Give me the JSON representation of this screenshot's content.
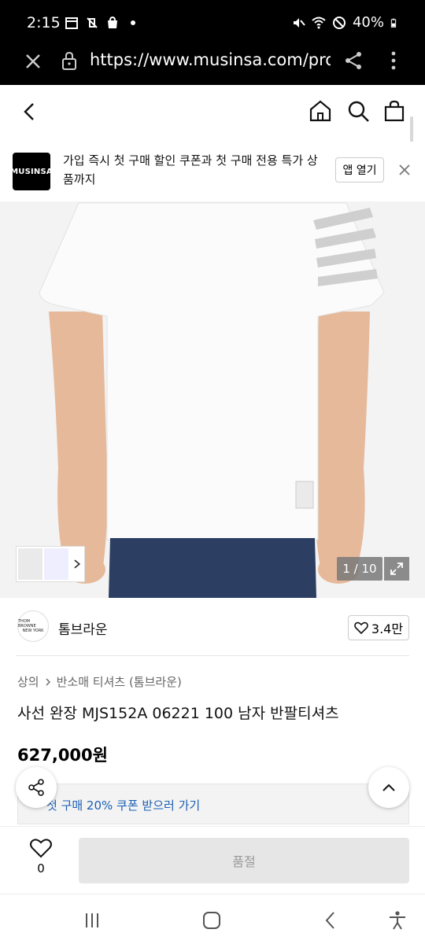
{
  "status_bar": {
    "time": "2:15",
    "battery": "40%"
  },
  "browser": {
    "url": "https://www.musinsa.com/produ"
  },
  "app_banner": {
    "logo_text": "MUSINSA",
    "message": "가입 즉시 첫 구매 할인 쿠폰과 첫 구매 전용 특가 상품까지",
    "open_button": "앱 열기"
  },
  "gallery": {
    "counter": "1 / 10"
  },
  "brand": {
    "logo_line1": "THOM BROWNE",
    "logo_line2": "NEW YORK",
    "name": "톰브라운",
    "like_count": "3.4만"
  },
  "breadcrumb": {
    "items": [
      "상의",
      "반소매 티셔츠 (톰브라운)"
    ]
  },
  "product": {
    "title": "사선 완장 MJS152A 06221 100 남자 반팔티셔츠",
    "price": "627,000원",
    "coupon_text": "첫 구매 20% 쿠폰 받으러 가기"
  },
  "purchase_bar": {
    "wish_count": "0",
    "button_label": "품절"
  },
  "colors": {
    "coupon_blue": "#1a5fb4",
    "soldout_bg": "#e6e6e6",
    "soldout_text": "#999999"
  }
}
